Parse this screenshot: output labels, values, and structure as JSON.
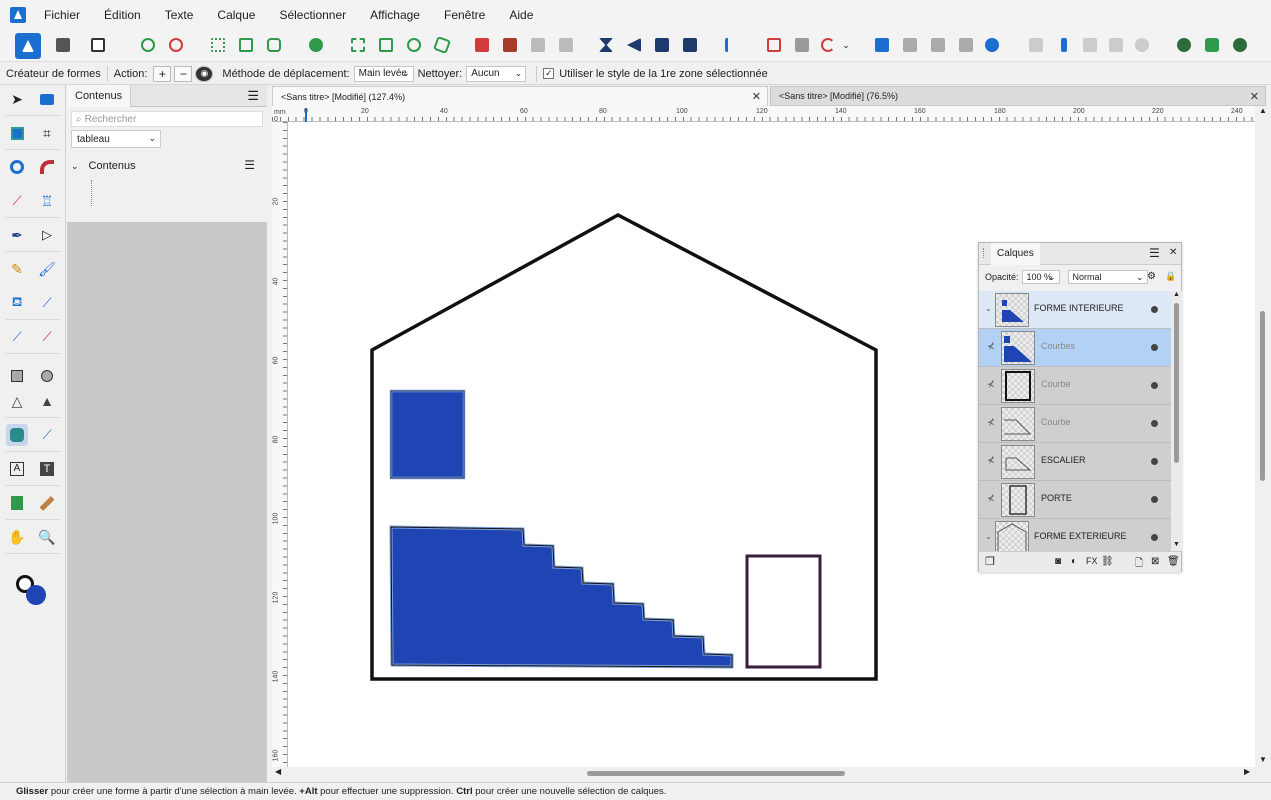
{
  "menubar": {
    "items": [
      "Fichier",
      "Édition",
      "Texte",
      "Calque",
      "Sélectionner",
      "Affichage",
      "Fenêtre",
      "Aide"
    ]
  },
  "contextbar": {
    "tool_name": "Créateur de formes",
    "action_label": "Action:",
    "move_method_label": "Méthode de déplacement:",
    "move_method_value": "Main levée",
    "clean_label": "Nettoyer:",
    "clean_value": "Aucun",
    "use_style_label": "Utiliser le style de la 1re zone sélectionnée",
    "use_style_checked": true
  },
  "contents_panel": {
    "tab": "Contenus",
    "search_placeholder": "Rechercher",
    "source_value": "tableau",
    "section_title": "Contenus"
  },
  "documents": {
    "tab1": "<Sans titre> [Modifié] (127.4%)",
    "tab2": "<Sans titre> [Modifié] (76.5%)"
  },
  "rulers": {
    "unit": "mm",
    "top_ticks": [
      "0",
      "20",
      "40",
      "60",
      "80",
      "100",
      "120",
      "140",
      "160",
      "180",
      "200",
      "220",
      "240"
    ],
    "left_ticks": [
      "0",
      "20",
      "40",
      "60",
      "80",
      "100",
      "120",
      "140",
      "160"
    ]
  },
  "layers_panel": {
    "tab": "Calques",
    "opacity_label": "Opacité:",
    "opacity_value": "100 %",
    "blend_value": "Normal",
    "rows": [
      {
        "name": "FORME INTERIEURE",
        "dim": false
      },
      {
        "name": "Courbes",
        "dim": true
      },
      {
        "name": "Courbe",
        "dim": true
      },
      {
        "name": "Courbe",
        "dim": true
      },
      {
        "name": "ESCALIER",
        "dim": false
      },
      {
        "name": "PORTE",
        "dim": false
      },
      {
        "name": "FORME EXTERIEURE",
        "dim": false
      }
    ]
  },
  "statusbar": {
    "k1": "Glisser",
    "t1": " pour créer une forme à partir d'une sélection à main levée. ",
    "k2": "+Alt",
    "t2": " pour effectuer une suppression. ",
    "k3": "Ctrl",
    "t3": " pour créer une nouvelle sélection de calques."
  },
  "colors": {
    "accent": "#1b6fd1",
    "fill_blue": "#1f45b5",
    "fill_outline": "#7fa0d8",
    "door_stroke": "#3a1d3a"
  }
}
